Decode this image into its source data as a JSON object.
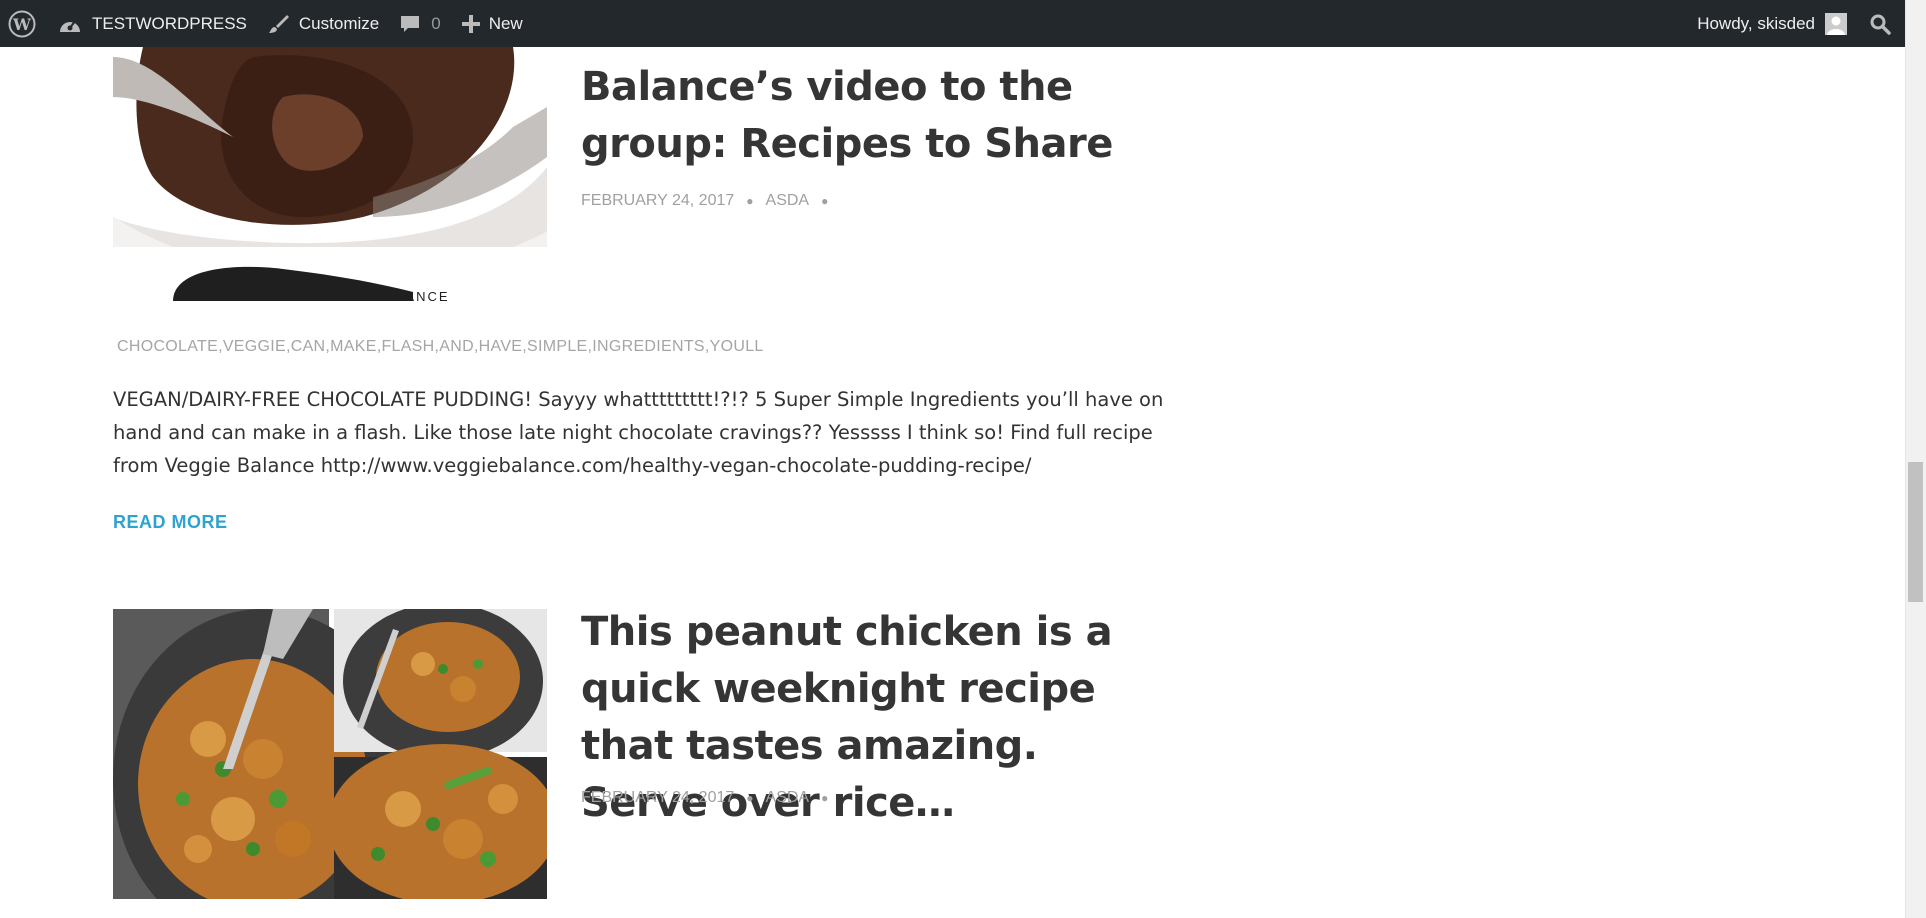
{
  "adminbar": {
    "site_name": "TESTWORDPRESS",
    "customize_label": "Customize",
    "comments_count": "0",
    "new_label": "New",
    "greeting": "Howdy, skisded"
  },
  "posts": [
    {
      "title_partial": "Balance’s video to the group: Recipes to Share",
      "date": "FEBRUARY 24, 2017",
      "author": "ASDA",
      "tags": "CHOCOLATE,VEGGIE,CAN,MAKE,FLASH,AND,HAVE,SIMPLE,INGREDIENTS,YOULL",
      "excerpt": "VEGAN/DAIRY-FREE CHOCOLATE PUDDING! Sayyy whattttttttt!?!? 5 Super Simple Ingredients you’ll have on hand and can make in a flash. Like those late night chocolate cravings?? Yesssss I think so! Find full recipe from Veggie Balance http://www.veggiebalance.com/healthy-vegan-chocolate-pudding-recipe/",
      "read_more": "READ MORE",
      "image_text": "VEGGIEBALANCE"
    },
    {
      "title": "This peanut chicken is a quick weeknight recipe that tastes amazing. Serve over rice…",
      "date": "FEBRUARY 24, 2017",
      "author": "ASDA"
    }
  ],
  "colors": {
    "adminbar_bg": "#23282d",
    "link_accent": "#2ea3d2",
    "meta_gray": "#a0a0a0"
  }
}
